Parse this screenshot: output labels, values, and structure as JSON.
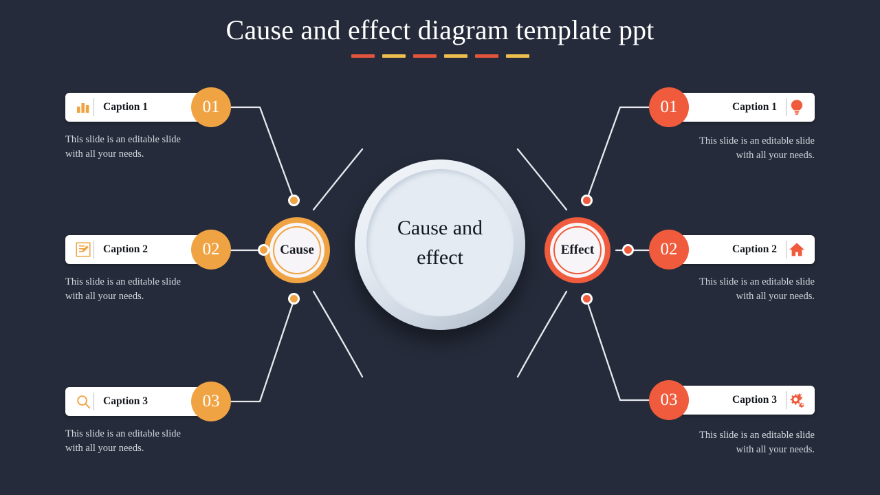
{
  "title": "Cause and effect diagram template ppt",
  "colors": {
    "background": "#252b3a",
    "orange": "#f0a343",
    "red": "#ef5b3c",
    "dash_red": "#e2543c",
    "dash_yellow": "#efbe4e",
    "card_bg": "#ffffff",
    "center_fill": "#e4ebf3",
    "connector": "#e8eaee",
    "body_text": "#d5d9e0"
  },
  "dashes": [
    "#e2543c",
    "#efbe4e",
    "#e2543c",
    "#efbe4e",
    "#e2543c",
    "#efbe4e"
  ],
  "center": {
    "label": "Cause and\neffect"
  },
  "hubs": {
    "cause": {
      "label": "Cause",
      "color": "#f0a343"
    },
    "effect": {
      "label": "Effect",
      "color": "#ef5b3c"
    }
  },
  "left_items": [
    {
      "number": "01",
      "caption": "Caption 1",
      "icon": "bar-chart-icon",
      "body": "This slide is an editable slide\nwith all your needs."
    },
    {
      "number": "02",
      "caption": "Caption 2",
      "icon": "clipboard-edit-icon",
      "body": "This slide is an editable slide\nwith all your needs."
    },
    {
      "number": "03",
      "caption": "Caption 3",
      "icon": "search-icon",
      "body": "This slide is an editable slide\nwith all your needs."
    }
  ],
  "right_items": [
    {
      "number": "01",
      "caption": "Caption 1",
      "icon": "lightbulb-icon",
      "body": "This slide is an editable slide\nwith all your needs."
    },
    {
      "number": "02",
      "caption": "Caption 2",
      "icon": "home-icon",
      "body": "This slide is an editable slide\nwith all your needs."
    },
    {
      "number": "03",
      "caption": "Caption 3",
      "icon": "gears-icon",
      "body": "This slide is an editable slide\nwith all your needs."
    }
  ]
}
